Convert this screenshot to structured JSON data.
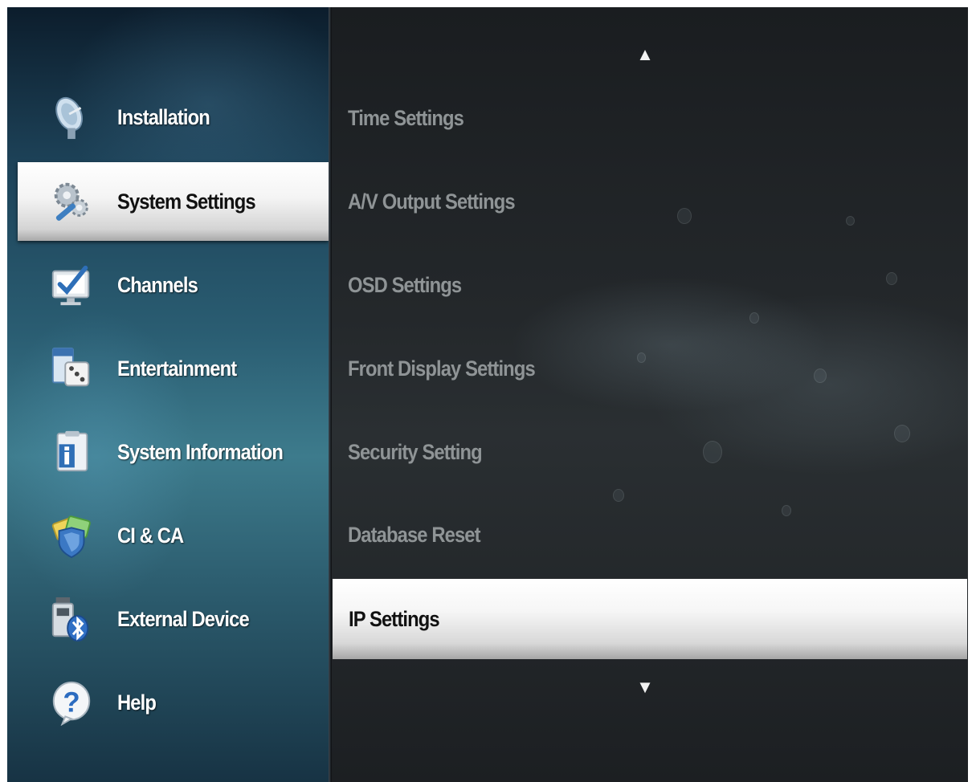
{
  "categories": [
    {
      "label": "Installation",
      "icon": "satellite-dish-icon",
      "selected": false
    },
    {
      "label": "System Settings",
      "icon": "gears-wrench-icon",
      "selected": true
    },
    {
      "label": "Channels",
      "icon": "monitor-checkmark-icon",
      "selected": false
    },
    {
      "label": "Entertainment",
      "icon": "dice-calendar-icon",
      "selected": false
    },
    {
      "label": "System Information",
      "icon": "info-clipboard-icon",
      "selected": false
    },
    {
      "label": "CI & CA",
      "icon": "shield-card-icon",
      "selected": false
    },
    {
      "label": "External Device",
      "icon": "usb-bluetooth-icon",
      "selected": false
    },
    {
      "label": "Help",
      "icon": "question-bubble-icon",
      "selected": false
    }
  ],
  "settings": {
    "items": [
      {
        "label": "Time Settings",
        "selected": false
      },
      {
        "label": "A/V Output Settings",
        "selected": false
      },
      {
        "label": "OSD Settings",
        "selected": false
      },
      {
        "label": "Front Display Settings",
        "selected": false
      },
      {
        "label": "Security Setting",
        "selected": false
      },
      {
        "label": "Database Reset",
        "selected": false
      },
      {
        "label": "IP Settings",
        "selected": true
      }
    ],
    "scroll_up_glyph": "▲",
    "scroll_down_glyph": "▼"
  },
  "colors": {
    "selection_highlight": "#f4f4f4",
    "left_panel_accent": "#2a5d72",
    "right_panel_background": "#24282b",
    "unselected_setting_text": "#8f9496"
  }
}
